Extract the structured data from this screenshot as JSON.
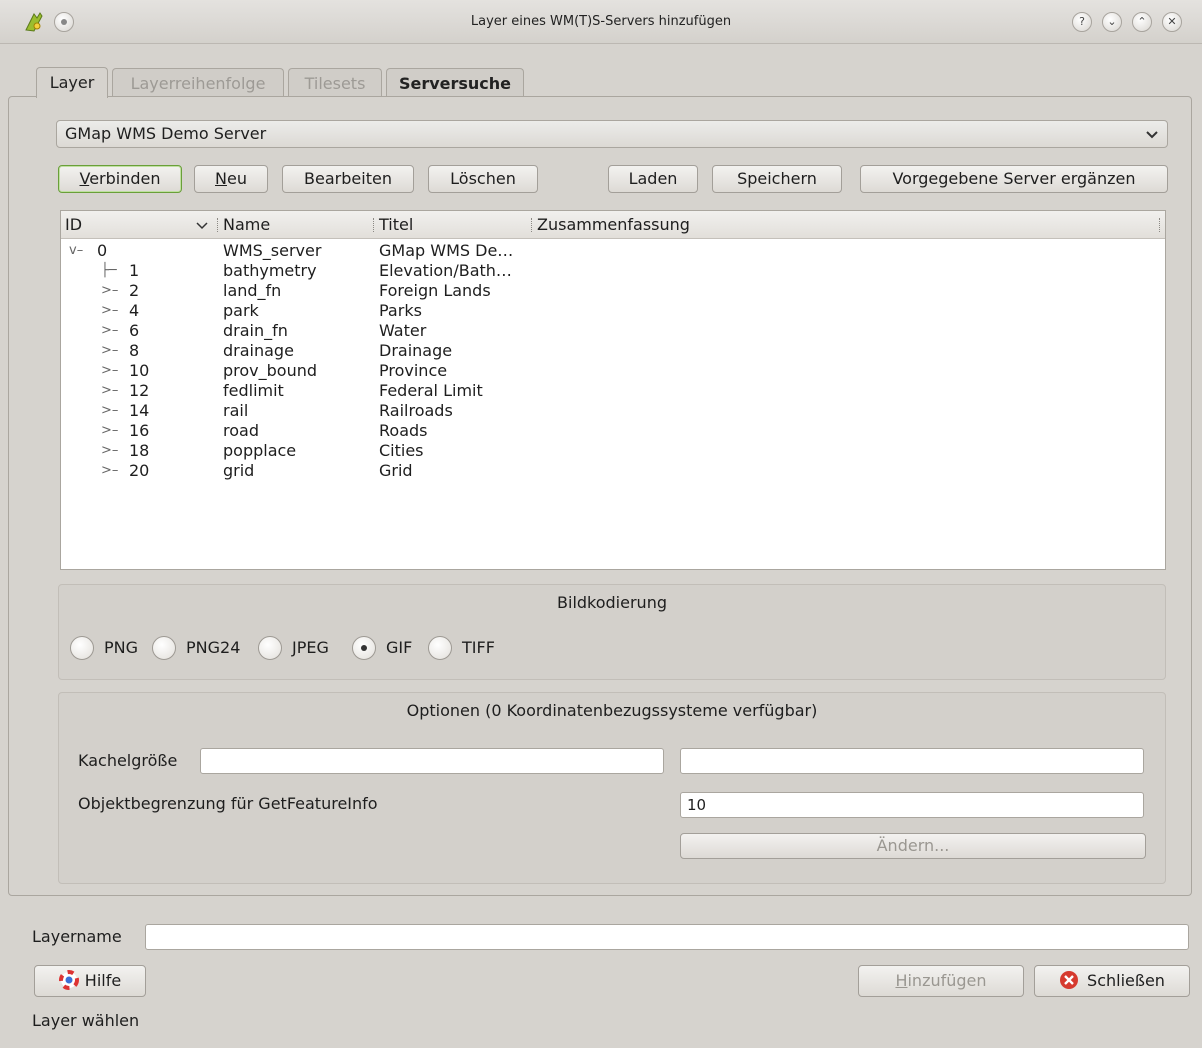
{
  "window": {
    "title": "Layer eines WM(T)S-Servers hinzufügen",
    "controls": [
      "?",
      "⌄",
      "⌃",
      "✕"
    ]
  },
  "tabs": [
    {
      "label": "Layer",
      "state": "active"
    },
    {
      "label": "Layerreihenfolge",
      "state": "disabled"
    },
    {
      "label": "Tilesets",
      "state": "disabled"
    },
    {
      "label": "Serversuche",
      "state": "normal"
    }
  ],
  "server_combo": {
    "value": "GMap WMS Demo Server"
  },
  "buttons": {
    "connect": {
      "mnemonic": "V",
      "rest": "erbinden"
    },
    "new": {
      "mnemonic": "N",
      "rest": "eu"
    },
    "edit": "Bearbeiten",
    "delete": "Löschen",
    "load": "Laden",
    "save": "Speichern",
    "add_default": "Vorgegebene Server ergänzen"
  },
  "tree": {
    "columns": [
      "ID",
      "Name",
      "Titel",
      "Zusammenfassung"
    ],
    "rows": [
      {
        "id": "0",
        "name": "WMS_server",
        "title": "GMap WMS De…",
        "branch": "root"
      },
      {
        "id": "1",
        "name": "bathymetry",
        "title": "Elevation/Bath…",
        "branch": "leaf"
      },
      {
        "id": "2",
        "name": "land_fn",
        "title": "Foreign Lands",
        "branch": "collapsed"
      },
      {
        "id": "4",
        "name": "park",
        "title": "Parks",
        "branch": "collapsed"
      },
      {
        "id": "6",
        "name": "drain_fn",
        "title": "Water",
        "branch": "collapsed"
      },
      {
        "id": "8",
        "name": "drainage",
        "title": "Drainage",
        "branch": "collapsed"
      },
      {
        "id": "10",
        "name": "prov_bound",
        "title": "Province",
        "branch": "collapsed"
      },
      {
        "id": "12",
        "name": "fedlimit",
        "title": "Federal Limit",
        "branch": "collapsed"
      },
      {
        "id": "14",
        "name": "rail",
        "title": "Railroads",
        "branch": "collapsed"
      },
      {
        "id": "16",
        "name": "road",
        "title": "Roads",
        "branch": "collapsed"
      },
      {
        "id": "18",
        "name": "popplace",
        "title": "Cities",
        "branch": "collapsed"
      },
      {
        "id": "20",
        "name": "grid",
        "title": "Grid",
        "branch": "collapsed"
      }
    ]
  },
  "encoding": {
    "title": "Bildkodierung",
    "options": [
      "PNG",
      "PNG24",
      "JPEG",
      "GIF",
      "TIFF"
    ],
    "selected": "GIF"
  },
  "options": {
    "title": "Optionen (0 Koordinatenbezugssysteme verfügbar)",
    "tile_size_label": "Kachelgröße",
    "tile_width": "",
    "tile_height": "",
    "feature_limit_label": "Objektbegrenzung für GetFeatureInfo",
    "feature_limit_value": "10",
    "change_button": "Ändern..."
  },
  "layer_name": {
    "label": "Layername",
    "value": ""
  },
  "footer": {
    "help": "Hilfe",
    "add": {
      "mnemonic": "H",
      "rest": "inzufügen"
    },
    "close": "Schließen",
    "status": "Layer wählen"
  }
}
